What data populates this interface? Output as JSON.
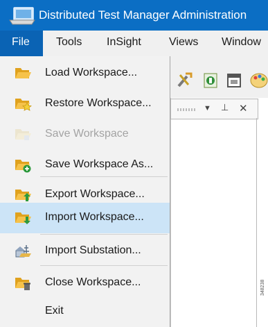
{
  "window": {
    "title": "Distributed Test Manager Administration"
  },
  "menubar": {
    "items": [
      "File",
      "Tools",
      "InSight",
      "Views",
      "Window"
    ]
  },
  "file_menu": {
    "items": [
      {
        "label": "Load Workspace...",
        "icon": "folder-open-icon",
        "enabled": true
      },
      {
        "label": "Restore Workspace...",
        "icon": "folder-star-icon",
        "enabled": true
      },
      {
        "label": "Save Workspace",
        "icon": "folder-save-icon",
        "enabled": false
      },
      {
        "label": "Save Workspace As...",
        "icon": "folder-add-icon",
        "enabled": true
      },
      {
        "label": "Export Workspace...",
        "icon": "folder-export-icon",
        "enabled": true
      },
      {
        "label": "Import Workspace...",
        "icon": "folder-import-icon",
        "enabled": true,
        "highlighted": true
      },
      {
        "label": "Import Substation...",
        "icon": "substation-icon",
        "enabled": true
      },
      {
        "label": "Close Workspace...",
        "icon": "folder-close-icon",
        "enabled": true
      },
      {
        "label": "Exit",
        "icon": "",
        "enabled": true
      }
    ]
  },
  "panel": {
    "dropdown_glyph": "▼",
    "pin_glyph": "⊥",
    "close_glyph": "✕"
  },
  "watermark": "348238",
  "colors": {
    "titlebar": "#0b6ec4",
    "menu_active": "#0a63b4",
    "highlight": "#cce4f7",
    "folder": "#f3b32a",
    "disabled_text": "#a3a3a3"
  }
}
